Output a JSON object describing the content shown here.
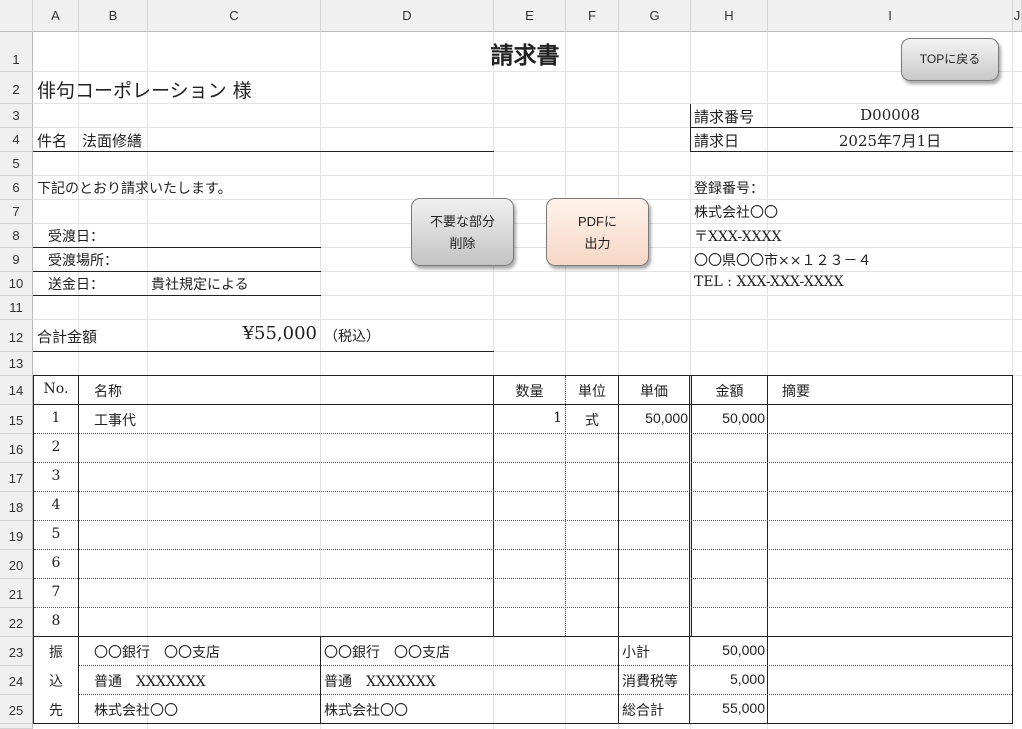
{
  "columns": [
    "A",
    "B",
    "C",
    "D",
    "E",
    "F",
    "G",
    "H",
    "I",
    "J"
  ],
  "rows": [
    "1",
    "2",
    "3",
    "4",
    "5",
    "6",
    "7",
    "8",
    "9",
    "10",
    "11",
    "12",
    "13",
    "14",
    "15",
    "16",
    "17",
    "18",
    "19",
    "20",
    "21",
    "22",
    "23",
    "24",
    "25"
  ],
  "invoice": {
    "title": "請求書",
    "customer": "俳句コーポレーション 様",
    "subject_label": "件名",
    "subject": "法面修繕",
    "intro": "下記のとおり請求いたします。",
    "delivery_date_label": "受渡日：",
    "delivery_place_label": "受渡場所：",
    "payment_label": "送金日：",
    "payment_value": "貴社規定による",
    "total_label": "合計金額",
    "total_value": "¥55,000",
    "tax_note": "（税込）",
    "number_label": "請求番号",
    "number_value": "D00008",
    "date_label": "請求日",
    "date_value": "2025年7月1日",
    "registration_label": "登録番号：",
    "company": "株式会社〇〇",
    "postal": "〒XXX-XXXX",
    "address": "〇〇県〇〇市××１２３－４",
    "tel": "TEL : XXX-XXX-XXXX"
  },
  "buttons": {
    "top": "TOPに戻る",
    "delete_line1": "不要な部分",
    "delete_line2": "削除",
    "pdf_line1": "PDFに",
    "pdf_line2": "出力"
  },
  "table": {
    "headers": {
      "no": "No.",
      "name": "名称",
      "qty": "数量",
      "unit": "単位",
      "price": "単価",
      "amount": "金額",
      "note": "摘要"
    },
    "items": [
      {
        "no": "1",
        "name": "工事代",
        "qty": "1",
        "unit": "式",
        "price": "50,000",
        "amount": "50,000"
      },
      {
        "no": "2"
      },
      {
        "no": "3"
      },
      {
        "no": "4"
      },
      {
        "no": "5"
      },
      {
        "no": "6"
      },
      {
        "no": "7"
      },
      {
        "no": "8"
      }
    ]
  },
  "bank": {
    "label": [
      "振",
      "込",
      "先"
    ],
    "bank1": "〇〇銀行　〇〇支店",
    "account1": "普通　XXXXXXX",
    "holder1": "株式会社〇〇",
    "bank2": "〇〇銀行　〇〇支店",
    "account2": "普通　XXXXXXX",
    "holder2": "株式会社〇〇"
  },
  "totals": {
    "subtotal_label": "小計",
    "subtotal": "50,000",
    "tax_label": "消費税等",
    "tax": "5,000",
    "grand_label": "総合計",
    "grand": "55,000"
  }
}
